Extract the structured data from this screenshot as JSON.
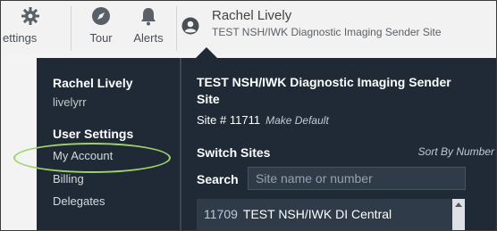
{
  "nav": {
    "settings_label": "ettings",
    "tour_label": "Tour",
    "alerts_label": "Alerts"
  },
  "user": {
    "name": "Rachel Lively",
    "site": "TEST NSH/IWK Diagnostic Imaging Sender Site"
  },
  "dropdown": {
    "name": "Rachel Lively",
    "username": "livelyrr",
    "user_settings_heading": "User Settings",
    "links": [
      "My Account",
      "Billing",
      "Delegates"
    ],
    "site_title": "TEST NSH/IWK Diagnostic Imaging Sender Site",
    "site_number_label": "Site # 11711",
    "make_default": "Make Default",
    "switch_sites_heading": "Switch Sites",
    "sort_label": "Sort By Number",
    "search_label": "Search",
    "search_placeholder": "Site name or number",
    "site_list": [
      {
        "number": "11709",
        "name": "TEST NSH/IWK DI Central"
      }
    ]
  },
  "colors": {
    "panel_bg": "#1f2a36",
    "highlight": "#9ed36a"
  },
  "icons": {
    "settings": "gear-icon",
    "tour": "compass-icon",
    "alerts": "bell-icon",
    "user": "user-circle-icon"
  }
}
